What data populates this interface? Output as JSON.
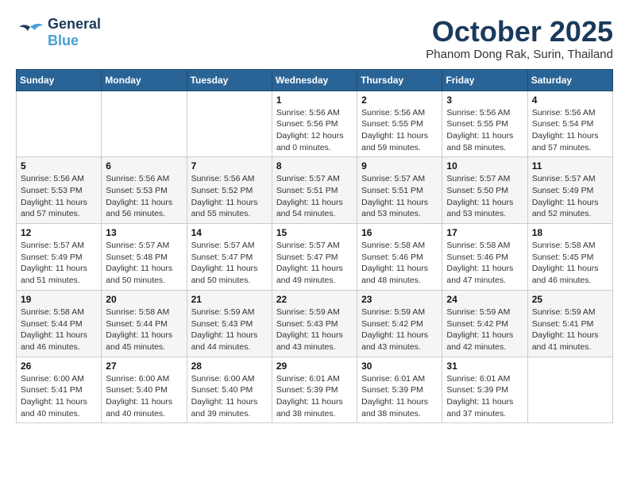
{
  "header": {
    "logo_line1": "General",
    "logo_line2": "Blue",
    "month_title": "October 2025",
    "subtitle": "Phanom Dong Rak, Surin, Thailand"
  },
  "weekdays": [
    "Sunday",
    "Monday",
    "Tuesday",
    "Wednesday",
    "Thursday",
    "Friday",
    "Saturday"
  ],
  "weeks": [
    [
      {
        "day": "",
        "info": ""
      },
      {
        "day": "",
        "info": ""
      },
      {
        "day": "",
        "info": ""
      },
      {
        "day": "1",
        "info": "Sunrise: 5:56 AM\nSunset: 5:56 PM\nDaylight: 12 hours\nand 0 minutes."
      },
      {
        "day": "2",
        "info": "Sunrise: 5:56 AM\nSunset: 5:55 PM\nDaylight: 11 hours\nand 59 minutes."
      },
      {
        "day": "3",
        "info": "Sunrise: 5:56 AM\nSunset: 5:55 PM\nDaylight: 11 hours\nand 58 minutes."
      },
      {
        "day": "4",
        "info": "Sunrise: 5:56 AM\nSunset: 5:54 PM\nDaylight: 11 hours\nand 57 minutes."
      }
    ],
    [
      {
        "day": "5",
        "info": "Sunrise: 5:56 AM\nSunset: 5:53 PM\nDaylight: 11 hours\nand 57 minutes."
      },
      {
        "day": "6",
        "info": "Sunrise: 5:56 AM\nSunset: 5:53 PM\nDaylight: 11 hours\nand 56 minutes."
      },
      {
        "day": "7",
        "info": "Sunrise: 5:56 AM\nSunset: 5:52 PM\nDaylight: 11 hours\nand 55 minutes."
      },
      {
        "day": "8",
        "info": "Sunrise: 5:57 AM\nSunset: 5:51 PM\nDaylight: 11 hours\nand 54 minutes."
      },
      {
        "day": "9",
        "info": "Sunrise: 5:57 AM\nSunset: 5:51 PM\nDaylight: 11 hours\nand 53 minutes."
      },
      {
        "day": "10",
        "info": "Sunrise: 5:57 AM\nSunset: 5:50 PM\nDaylight: 11 hours\nand 53 minutes."
      },
      {
        "day": "11",
        "info": "Sunrise: 5:57 AM\nSunset: 5:49 PM\nDaylight: 11 hours\nand 52 minutes."
      }
    ],
    [
      {
        "day": "12",
        "info": "Sunrise: 5:57 AM\nSunset: 5:49 PM\nDaylight: 11 hours\nand 51 minutes."
      },
      {
        "day": "13",
        "info": "Sunrise: 5:57 AM\nSunset: 5:48 PM\nDaylight: 11 hours\nand 50 minutes."
      },
      {
        "day": "14",
        "info": "Sunrise: 5:57 AM\nSunset: 5:47 PM\nDaylight: 11 hours\nand 50 minutes."
      },
      {
        "day": "15",
        "info": "Sunrise: 5:57 AM\nSunset: 5:47 PM\nDaylight: 11 hours\nand 49 minutes."
      },
      {
        "day": "16",
        "info": "Sunrise: 5:58 AM\nSunset: 5:46 PM\nDaylight: 11 hours\nand 48 minutes."
      },
      {
        "day": "17",
        "info": "Sunrise: 5:58 AM\nSunset: 5:46 PM\nDaylight: 11 hours\nand 47 minutes."
      },
      {
        "day": "18",
        "info": "Sunrise: 5:58 AM\nSunset: 5:45 PM\nDaylight: 11 hours\nand 46 minutes."
      }
    ],
    [
      {
        "day": "19",
        "info": "Sunrise: 5:58 AM\nSunset: 5:44 PM\nDaylight: 11 hours\nand 46 minutes."
      },
      {
        "day": "20",
        "info": "Sunrise: 5:58 AM\nSunset: 5:44 PM\nDaylight: 11 hours\nand 45 minutes."
      },
      {
        "day": "21",
        "info": "Sunrise: 5:59 AM\nSunset: 5:43 PM\nDaylight: 11 hours\nand 44 minutes."
      },
      {
        "day": "22",
        "info": "Sunrise: 5:59 AM\nSunset: 5:43 PM\nDaylight: 11 hours\nand 43 minutes."
      },
      {
        "day": "23",
        "info": "Sunrise: 5:59 AM\nSunset: 5:42 PM\nDaylight: 11 hours\nand 43 minutes."
      },
      {
        "day": "24",
        "info": "Sunrise: 5:59 AM\nSunset: 5:42 PM\nDaylight: 11 hours\nand 42 minutes."
      },
      {
        "day": "25",
        "info": "Sunrise: 5:59 AM\nSunset: 5:41 PM\nDaylight: 11 hours\nand 41 minutes."
      }
    ],
    [
      {
        "day": "26",
        "info": "Sunrise: 6:00 AM\nSunset: 5:41 PM\nDaylight: 11 hours\nand 40 minutes."
      },
      {
        "day": "27",
        "info": "Sunrise: 6:00 AM\nSunset: 5:40 PM\nDaylight: 11 hours\nand 40 minutes."
      },
      {
        "day": "28",
        "info": "Sunrise: 6:00 AM\nSunset: 5:40 PM\nDaylight: 11 hours\nand 39 minutes."
      },
      {
        "day": "29",
        "info": "Sunrise: 6:01 AM\nSunset: 5:39 PM\nDaylight: 11 hours\nand 38 minutes."
      },
      {
        "day": "30",
        "info": "Sunrise: 6:01 AM\nSunset: 5:39 PM\nDaylight: 11 hours\nand 38 minutes."
      },
      {
        "day": "31",
        "info": "Sunrise: 6:01 AM\nSunset: 5:39 PM\nDaylight: 11 hours\nand 37 minutes."
      },
      {
        "day": "",
        "info": ""
      }
    ]
  ]
}
